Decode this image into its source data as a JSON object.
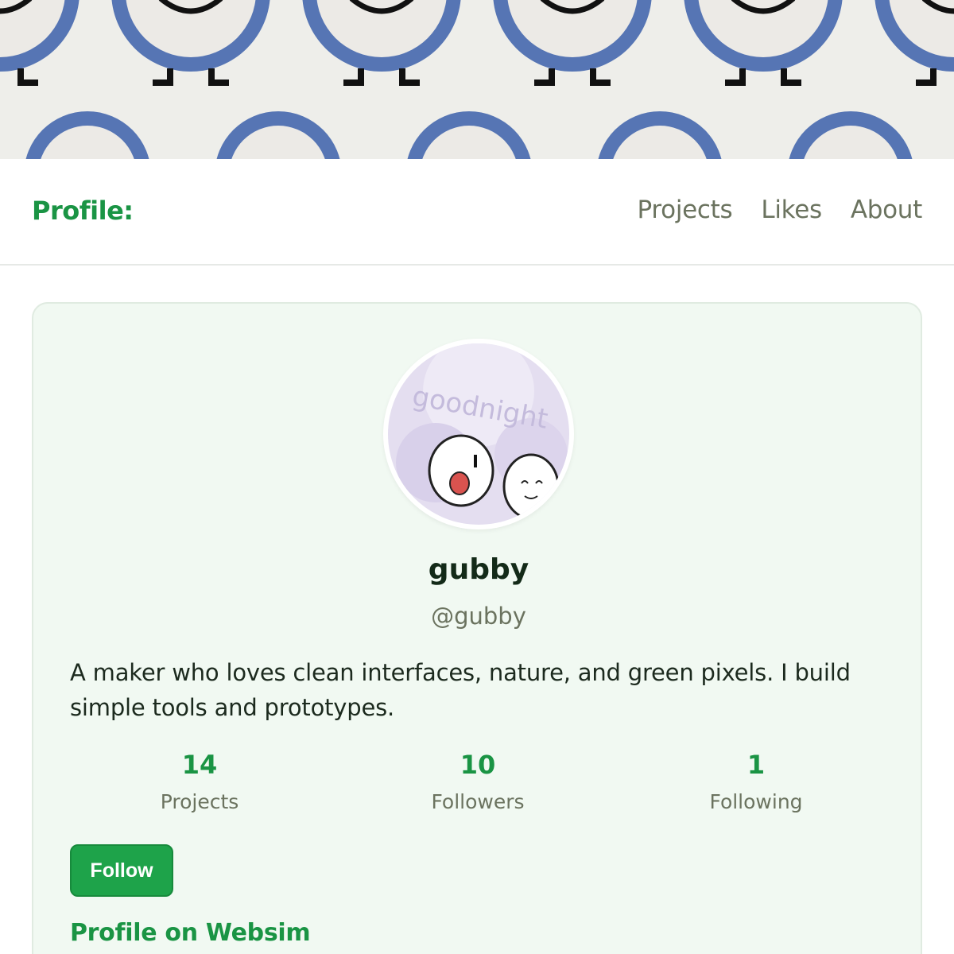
{
  "banner": {
    "pattern": "clock-character-tile"
  },
  "header": {
    "title": "Profile:",
    "nav": [
      {
        "label": "Projects"
      },
      {
        "label": "Likes"
      },
      {
        "label": "About"
      }
    ]
  },
  "profile": {
    "avatar_label": "goodnight",
    "display_name": "gubby",
    "handle": "@gubby",
    "bio": "A maker who loves clean interfaces, nature, and green pixels. I build simple tools and prototypes.",
    "stats": [
      {
        "value": "14",
        "label": "Projects"
      },
      {
        "value": "10",
        "label": "Followers"
      },
      {
        "value": "1",
        "label": "Following"
      }
    ],
    "follow_label": "Follow",
    "websim_link": "Profile on Websim"
  },
  "colors": {
    "accent": "#1a9444",
    "button": "#1ea34a",
    "card_bg": "#f1f9f2",
    "muted": "#6b735f"
  }
}
